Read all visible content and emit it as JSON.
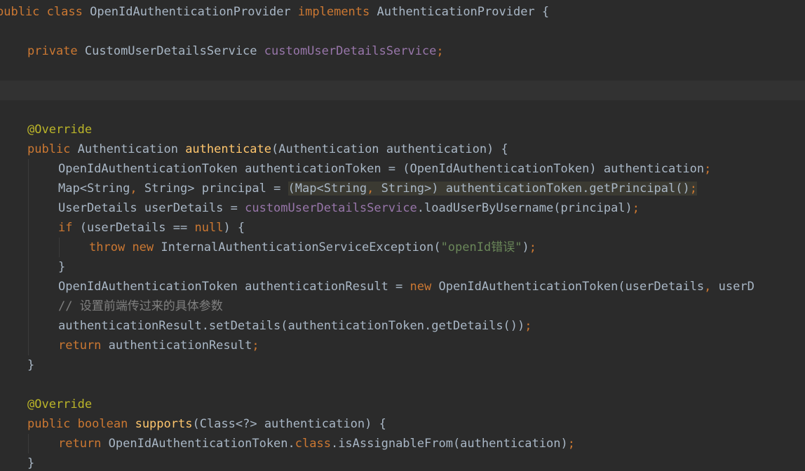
{
  "lines": [
    {
      "indent": 0,
      "spans": [
        {
          "t": "public",
          "c": "kw"
        },
        {
          "t": " "
        },
        {
          "t": "class",
          "c": "kw"
        },
        {
          "t": " OpenIdAuthenticationProvider "
        },
        {
          "t": "implements",
          "c": "kw"
        },
        {
          "t": " AuthenticationProvider {"
        }
      ]
    },
    {
      "indent": 0,
      "spans": []
    },
    {
      "indent": 1,
      "spans": [
        {
          "t": "private",
          "c": "kw"
        },
        {
          "t": " CustomUserDetailsService "
        },
        {
          "t": "customUserDetailsService",
          "c": "fld"
        },
        {
          "t": ";",
          "c": "kw"
        }
      ]
    },
    {
      "indent": 0,
      "spans": []
    },
    {
      "indent": 0,
      "current": true,
      "spans": []
    },
    {
      "indent": 0,
      "spans": []
    },
    {
      "indent": 1,
      "spans": [
        {
          "t": "@Override",
          "c": "ann"
        }
      ]
    },
    {
      "indent": 1,
      "spans": [
        {
          "t": "public",
          "c": "kw"
        },
        {
          "t": " Authentication "
        },
        {
          "t": "authenticate",
          "c": "fn"
        },
        {
          "t": "(Authentication authentication) {"
        }
      ]
    },
    {
      "indent": 2,
      "spans": [
        {
          "t": "OpenIdAuthenticationToken authenticationToken = (OpenIdAuthenticationToken) authentication"
        },
        {
          "t": ";",
          "c": "kw"
        }
      ]
    },
    {
      "indent": 2,
      "spans": [
        {
          "t": "Map<String"
        },
        {
          "t": ",",
          "c": "kw"
        },
        {
          "t": " String> principal = "
        },
        {
          "t": "(Map<String",
          "h": true
        },
        {
          "t": ",",
          "c": "kw",
          "h": true
        },
        {
          "t": " String>) authenticationToken.getPrincipal()",
          "h": true
        },
        {
          "t": ";",
          "c": "kw",
          "h": true
        }
      ]
    },
    {
      "indent": 2,
      "spans": [
        {
          "t": "UserDetails userDetails = "
        },
        {
          "t": "customUserDetailsService",
          "c": "fld"
        },
        {
          "t": ".loadUserByUsername(principal)"
        },
        {
          "t": ";",
          "c": "kw"
        }
      ]
    },
    {
      "indent": 2,
      "spans": [
        {
          "t": "if",
          "c": "kw"
        },
        {
          "t": " (userDetails == "
        },
        {
          "t": "null",
          "c": "kw"
        },
        {
          "t": ") {"
        }
      ]
    },
    {
      "indent": 3,
      "spans": [
        {
          "t": "throw",
          "c": "kw"
        },
        {
          "t": " "
        },
        {
          "t": "new",
          "c": "kw"
        },
        {
          "t": " InternalAuthenticationServiceException("
        },
        {
          "t": "\"openId错误\"",
          "c": "str"
        },
        {
          "t": ")"
        },
        {
          "t": ";",
          "c": "kw"
        }
      ]
    },
    {
      "indent": 2,
      "spans": [
        {
          "t": "}"
        }
      ]
    },
    {
      "indent": 2,
      "spans": [
        {
          "t": "OpenIdAuthenticationToken authenticationResult = "
        },
        {
          "t": "new",
          "c": "kw"
        },
        {
          "t": " OpenIdAuthenticationToken(userDetails"
        },
        {
          "t": ",",
          "c": "kw"
        },
        {
          "t": " userD"
        }
      ]
    },
    {
      "indent": 2,
      "spans": [
        {
          "t": "// 设置前端传过来的具体参数",
          "c": "cmt"
        }
      ]
    },
    {
      "indent": 2,
      "spans": [
        {
          "t": "authenticationResult.setDetails(authenticationToken.getDetails())"
        },
        {
          "t": ";",
          "c": "kw"
        }
      ]
    },
    {
      "indent": 2,
      "spans": [
        {
          "t": "return",
          "c": "kw"
        },
        {
          "t": " authenticationResult"
        },
        {
          "t": ";",
          "c": "kw"
        }
      ]
    },
    {
      "indent": 1,
      "spans": [
        {
          "t": "}"
        }
      ]
    },
    {
      "indent": 0,
      "spans": []
    },
    {
      "indent": 1,
      "spans": [
        {
          "t": "@Override",
          "c": "ann"
        }
      ]
    },
    {
      "indent": 1,
      "spans": [
        {
          "t": "public",
          "c": "kw"
        },
        {
          "t": " "
        },
        {
          "t": "boolean",
          "c": "kw"
        },
        {
          "t": " "
        },
        {
          "t": "supports",
          "c": "fn"
        },
        {
          "t": "(Class<?> authentication) {"
        }
      ]
    },
    {
      "indent": 2,
      "spans": [
        {
          "t": "return",
          "c": "kw"
        },
        {
          "t": " OpenIdAuthenticationToken."
        },
        {
          "t": "class",
          "c": "kw"
        },
        {
          "t": ".isAssignableFrom(authentication)"
        },
        {
          "t": ";",
          "c": "kw"
        }
      ]
    },
    {
      "indent": 1,
      "spans": [
        {
          "t": "}"
        }
      ]
    }
  ]
}
